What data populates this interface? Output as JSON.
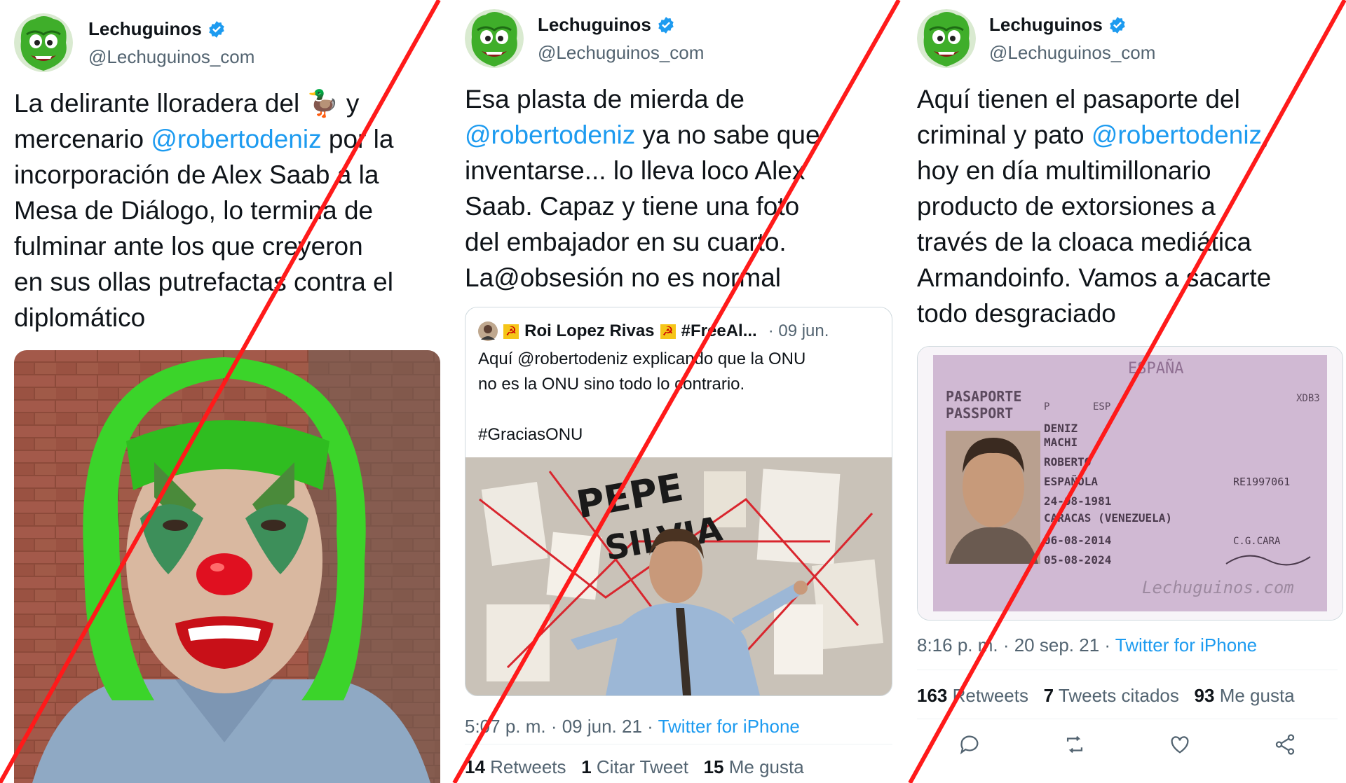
{
  "colors": {
    "accent": "#1d9bf0",
    "muted": "#536471",
    "strike": "#ff1a1a"
  },
  "account": {
    "name": "Lechuguinos",
    "handle": "@Lechuguinos_com",
    "verified_icon": "verified-badge-icon"
  },
  "tweet1": {
    "line1": "La delirante lloradera del",
    "emoji": "🦆",
    "line1b": " y",
    "mention_prefix": "mercenario ",
    "mention": "@robertodeniz",
    "mention_suffix": " por la",
    "rest": "incorporación de Alex Saab a la\nMesa de Diálogo, lo termina de\nfulminar ante los que creyeron\nen sus ollas putrefactas contra el\ndiplomático"
  },
  "tweet2": {
    "line1": "Esa plasta de mierda de",
    "mention": "@robertodeniz",
    "mention_suffix": " ya no sabe que",
    "rest": "inventarse... lo lleva loco Alex\nSaab. Capaz y tiene una foto\ndel embajador en su cuarto.\nLa@obsesión no es normal",
    "quote": {
      "author": "Roi Lopez Rivas",
      "emoji": "☭",
      "tag": "#FreeAl...",
      "date": "· 09 jun.",
      "text": "Aquí @robertodeniz explicando que la ONU\nno es la ONU sino todo lo contrario.\n\n#GraciasONU"
    },
    "timestamp": "5:07 p. m. · 09 jun. 21 · ",
    "source": "Twitter for iPhone",
    "retweets_count": "14",
    "retweets_label": " Retweets",
    "quotes_count": "1",
    "quotes_label": " Citar Tweet",
    "likes_count": "15",
    "likes_label": " Me gusta"
  },
  "tweet3": {
    "line1": "Aquí tienen el pasaporte del",
    "mention_prefix": "criminal y pato ",
    "mention": "@robertodeniz",
    "mention_suffix": ",",
    "rest": "hoy en día multimillonario\nproducto de extorsiones a\ntravés de la cloaca mediática\nArmandoinfo. Vamos a sacarte\ntodo desgraciado",
    "passport": {
      "country": "ESPAÑA",
      "title1": "PASAPORTE",
      "title2": "PASSPORT",
      "type": "P",
      "code": "ESP",
      "surname1": "DENIZ",
      "surname2": "MACHI",
      "given": "ROBERTO",
      "nationality": "ESPAÑOLA",
      "number": "RE1997061",
      "dob": "24-08-1981",
      "pob": "CARACAS (VENEZUELA)",
      "issue": "06-08-2014",
      "expiry": "05-08-2024",
      "authority": "C.G.CARA",
      "doc_no": "XDB3",
      "watermark": "Lechuguinos.com"
    },
    "timestamp": "8:16 p. m. · 20 sep. 21 · ",
    "source": "Twitter for iPhone",
    "retweets_count": "163",
    "retweets_label": " Retweets",
    "quotes_count": "7",
    "quotes_label": " Tweets citados",
    "likes_count": "93",
    "likes_label": " Me gusta"
  },
  "meme_text": {
    "line1": "PEPE",
    "line2": "SILVIA"
  }
}
